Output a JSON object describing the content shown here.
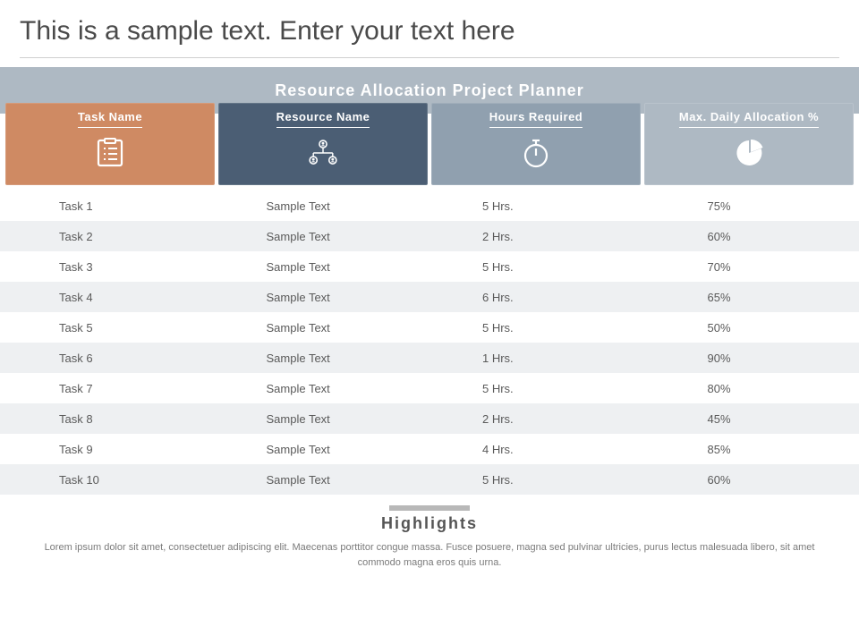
{
  "title": "This is a sample text. Enter your text here",
  "banner": "Resource Allocation Project Planner",
  "columns": {
    "task": "Task Name",
    "resource": "Resource Name",
    "hours": "Hours Required",
    "max": "Max. Daily Allocation  %"
  },
  "rows": [
    {
      "task": "Task 1",
      "resource": "Sample Text",
      "hours": "5 Hrs.",
      "max": "75%"
    },
    {
      "task": "Task 2",
      "resource": "Sample Text",
      "hours": "2 Hrs.",
      "max": "60%"
    },
    {
      "task": "Task 3",
      "resource": "Sample Text",
      "hours": "5 Hrs.",
      "max": "70%"
    },
    {
      "task": "Task 4",
      "resource": "Sample Text",
      "hours": "6 Hrs.",
      "max": "65%"
    },
    {
      "task": "Task 5",
      "resource": "Sample Text",
      "hours": "5 Hrs.",
      "max": "50%"
    },
    {
      "task": "Task 6",
      "resource": "Sample Text",
      "hours": "1 Hrs.",
      "max": "90%"
    },
    {
      "task": "Task 7",
      "resource": "Sample Text",
      "hours": "5 Hrs.",
      "max": "80%"
    },
    {
      "task": "Task 8",
      "resource": "Sample Text",
      "hours": "2 Hrs.",
      "max": "45%"
    },
    {
      "task": "Task 9",
      "resource": "Sample Text",
      "hours": "4 Hrs.",
      "max": "85%"
    },
    {
      "task": "Task 10",
      "resource": "Sample Text",
      "hours": "5 Hrs.",
      "max": "60%"
    }
  ],
  "highlights": {
    "title": "Highlights",
    "body": "Lorem ipsum dolor sit amet, consectetuer adipiscing elit. Maecenas porttitor congue massa. Fusce posuere, magna sed pulvinar ultricies, purus lectus malesuada libero, sit amet commodo magna eros quis urna."
  },
  "chart_data": {
    "type": "table",
    "title": "Resource Allocation Project Planner",
    "columns": [
      "Task Name",
      "Resource Name",
      "Hours Required",
      "Max. Daily Allocation %"
    ],
    "data": [
      [
        "Task 1",
        "Sample Text",
        5,
        75
      ],
      [
        "Task 2",
        "Sample Text",
        2,
        60
      ],
      [
        "Task 3",
        "Sample Text",
        5,
        70
      ],
      [
        "Task 4",
        "Sample Text",
        6,
        65
      ],
      [
        "Task 5",
        "Sample Text",
        5,
        50
      ],
      [
        "Task 6",
        "Sample Text",
        1,
        90
      ],
      [
        "Task 7",
        "Sample Text",
        5,
        80
      ],
      [
        "Task 8",
        "Sample Text",
        2,
        45
      ],
      [
        "Task 9",
        "Sample Text",
        4,
        85
      ],
      [
        "Task 10",
        "Sample Text",
        5,
        60
      ]
    ]
  }
}
